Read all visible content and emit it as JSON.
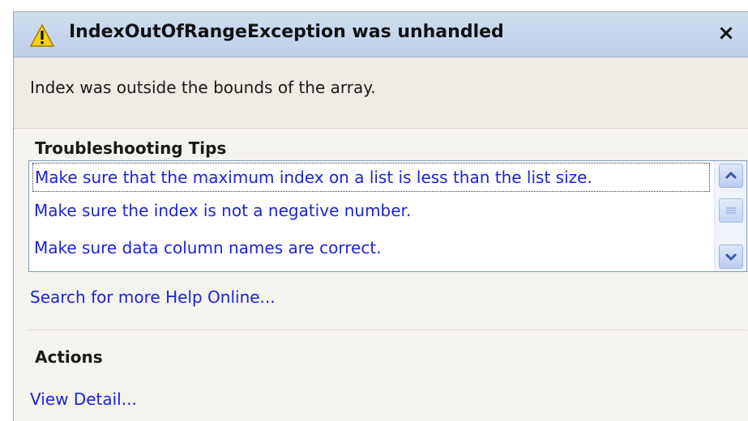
{
  "header": {
    "title": "IndexOutOfRangeException was unhandled",
    "warning_icon": "warning-triangle-icon",
    "close_label": "×"
  },
  "message": "Index was outside the bounds of the array.",
  "troubleshooting": {
    "heading": "Troubleshooting Tips",
    "tips": [
      "Make sure that the maximum index on a list is less than the list size.",
      "Make sure the index is not a negative number.",
      "Make sure data column names are correct."
    ],
    "selected_index": 0
  },
  "search_link": "Search for more Help Online...",
  "actions": {
    "heading": "Actions",
    "links": [
      "View Detail..."
    ]
  },
  "colors": {
    "link": "#1c24d8",
    "title_bar": "#c7d6ed",
    "background": "#f4f3ee"
  }
}
